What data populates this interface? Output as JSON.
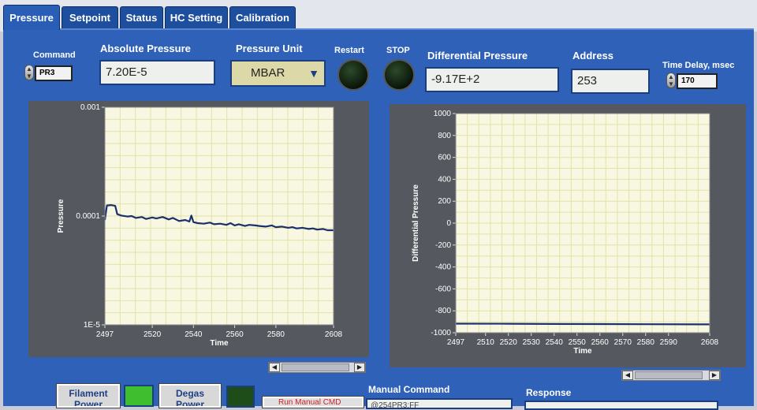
{
  "tabs": [
    {
      "label": "Pressure",
      "active": true
    },
    {
      "label": "Setpoint",
      "active": false
    },
    {
      "label": "Status",
      "active": false
    },
    {
      "label": "HC Setting",
      "active": false
    },
    {
      "label": "Calibration",
      "active": false
    }
  ],
  "controls": {
    "command_label": "Command",
    "command_value": "PR3",
    "absolute_pressure_label": "Absolute Pressure",
    "absolute_pressure_value": "7.20E-5",
    "pressure_unit_label": "Pressure Unit",
    "pressure_unit_value": "MBAR",
    "restart_label": "Restart",
    "stop_label": "STOP",
    "differential_pressure_label": "Differential Pressure",
    "differential_pressure_value": "-9.17E+2",
    "address_label": "Address",
    "address_value": "253",
    "time_delay_label": "Time Delay, msec",
    "time_delay_value": "170"
  },
  "bottom": {
    "filament_power_label": "Filament Power",
    "degas_label": "Degas Power",
    "manual_command_label": "Manual Command",
    "manual_command_value": "@254PR3;FF",
    "send_button_label": "Run Manual CMD",
    "response_label": "Response"
  },
  "colors": {
    "panel": "#2f61b8",
    "tab": "#1d4f9e",
    "plot_bg": "#f7f7e2",
    "grid": "#e3e3a6",
    "trace": "#1c2f6e",
    "led_green": "#3fbf2f"
  },
  "chart_data": [
    {
      "type": "line",
      "xlabel": "Time",
      "ylabel": "Pressure",
      "log_y": true,
      "ylim": [
        1e-05,
        0.001
      ],
      "y_ticks": [
        {
          "v": 0.001,
          "label": "0.001"
        },
        {
          "v": 0.0001,
          "label": "0.0001"
        },
        {
          "v": 1e-05,
          "label": "1E-5"
        }
      ],
      "xlim": [
        2497,
        2608
      ],
      "x_ticks": [
        2497,
        2520,
        2540,
        2560,
        2580,
        2608
      ],
      "grid": true,
      "series": [
        {
          "x": [
            2497,
            2498,
            2500,
            2502,
            2503,
            2505,
            2508,
            2510,
            2512,
            2515,
            2517,
            2520,
            2522,
            2525,
            2528,
            2530,
            2533,
            2536,
            2538,
            2539,
            2540,
            2542,
            2545,
            2548,
            2550,
            2553,
            2556,
            2558,
            2560,
            2562,
            2565,
            2567,
            2570,
            2572,
            2575,
            2578,
            2580,
            2583,
            2586,
            2588,
            2590,
            2593,
            2596,
            2598,
            2600,
            2603,
            2605,
            2608
          ],
          "y": [
            9.2e-05,
            0.000125,
            0.000126,
            0.000124,
            0.000104,
            0.000101,
            9.9e-05,
            0.0001,
            9.6e-05,
            9.8e-05,
            9.4e-05,
            9.7e-05,
            9.5e-05,
            9.8e-05,
            9.3e-05,
            9.6e-05,
            9e-05,
            9.2e-05,
            8.9e-05,
            0.000101,
            8.8e-05,
            8.6e-05,
            8.5e-05,
            8.7e-05,
            8.4e-05,
            8.5e-05,
            8.3e-05,
            8.6e-05,
            8.2e-05,
            8.4e-05,
            8.1e-05,
            8.3e-05,
            8.2e-05,
            8.1e-05,
            8e-05,
            8.2e-05,
            7.9e-05,
            8e-05,
            7.8e-05,
            7.9e-05,
            7.7e-05,
            7.8e-05,
            7.6e-05,
            7.7e-05,
            7.5e-05,
            7.6e-05,
            7.4e-05,
            7.4e-05
          ]
        }
      ]
    },
    {
      "type": "line",
      "xlabel": "Time",
      "ylabel": "Differential Pressure",
      "ylim": [
        -1000,
        1000
      ],
      "y_ticks": [
        1000,
        800,
        600,
        400,
        200,
        0,
        -200,
        -400,
        -600,
        -800,
        -1000
      ],
      "xlim": [
        2497,
        2608
      ],
      "x_ticks": [
        2497,
        2510,
        2520,
        2530,
        2540,
        2550,
        2560,
        2570,
        2580,
        2590,
        2608
      ],
      "grid": true,
      "series": [
        {
          "x": [
            2497,
            2520,
            2540,
            2560,
            2580,
            2608
          ],
          "y": [
            -917,
            -918,
            -920,
            -921,
            -922,
            -924
          ]
        }
      ]
    }
  ]
}
